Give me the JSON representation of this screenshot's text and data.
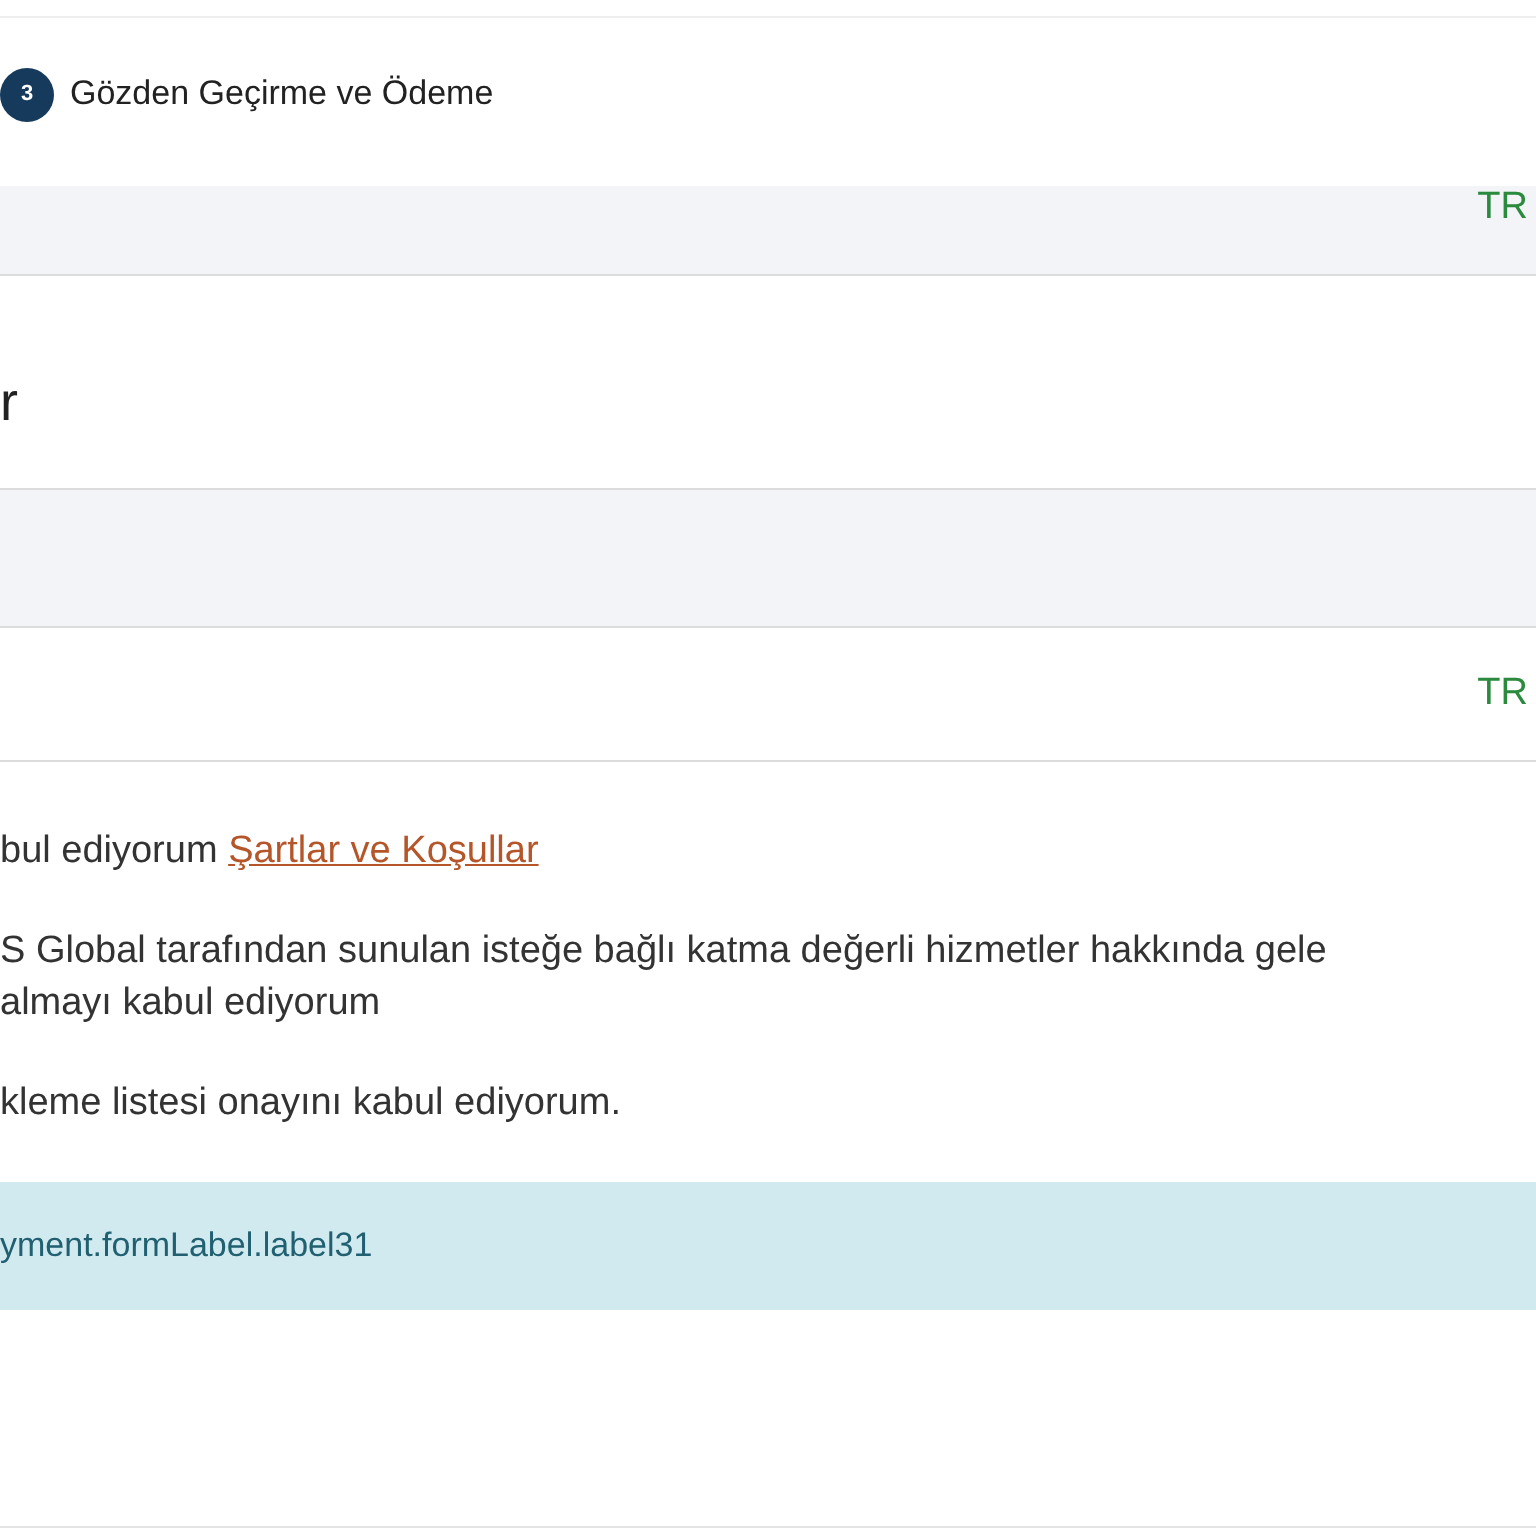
{
  "step": {
    "number": "3",
    "label": "Gözden Geçirme ve Ödeme"
  },
  "summary_rows": [
    {
      "kind": "price",
      "shaded": true,
      "value": "TR"
    },
    {
      "kind": "heading",
      "shaded": false,
      "value": "r"
    },
    {
      "kind": "blank",
      "shaded": true
    },
    {
      "kind": "price",
      "shaded": false,
      "value": "TR"
    }
  ],
  "agreements": [
    {
      "text": "bul ediyorum ",
      "link": "Şartlar ve Koşullar"
    },
    {
      "text": "S Global tarafından sunulan isteğe bağlı katma değerli hizmetler hakkında gele\nalmayı kabul ediyorum"
    },
    {
      "text": "kleme listesi onayını kabul ediyorum."
    }
  ],
  "info_banner": "yment.formLabel.label31"
}
